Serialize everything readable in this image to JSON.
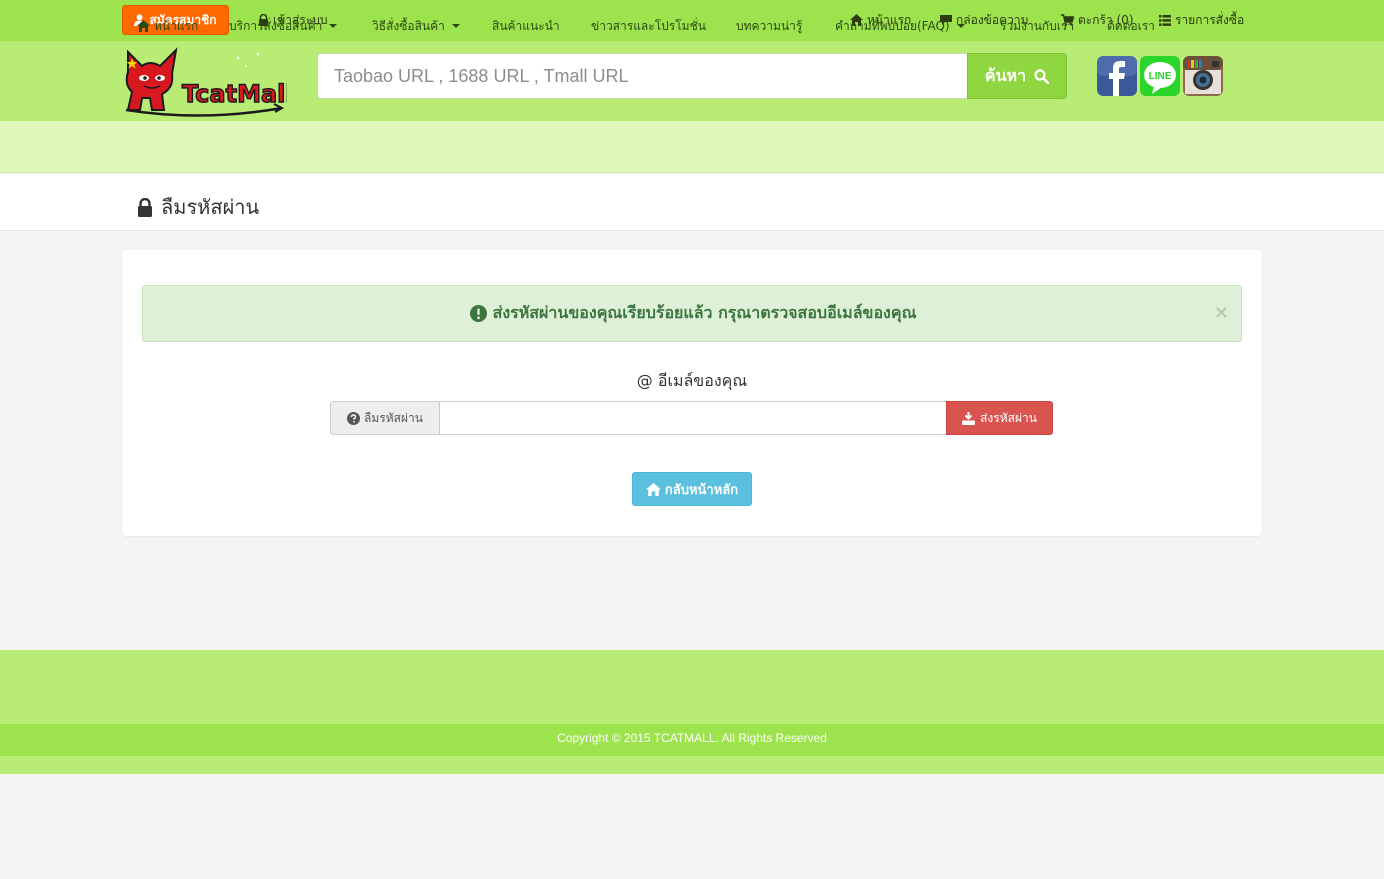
{
  "topbar": {
    "register_label": "สมัครสมาชิก",
    "login_label": "เข้าสู่ระบบ",
    "home_label": "หน้าแรก",
    "inbox_label": "กล่องข้อความ",
    "cart_label": "ตะกร้า (0)",
    "orders_label": "รายการสั่งซื้อ"
  },
  "header": {
    "logo_text": "TcatMall",
    "search": {
      "placeholder": "Taobao URL , 1688 URL , Tmall URL",
      "value": "",
      "button_label": "ค้นหา"
    },
    "social": [
      "facebook-icon",
      "line-icon",
      "instagram-icon"
    ],
    "social_line_text": "LINE"
  },
  "nav": {
    "items": [
      {
        "label": "หน้าแรก"
      },
      {
        "label": "บริการสั่งซื้อสินค้า"
      },
      {
        "label": "วิธีสั่งซื้อสินค้า"
      },
      {
        "label": "สินค้าแนะนำ"
      },
      {
        "label": "ข่าวสารและโปรโมชั่น"
      },
      {
        "label": "บทความน่ารู้"
      },
      {
        "label": "คำถามที่พบบ่อย(FAQ)"
      },
      {
        "label": "ร่วมงานกับเรา"
      },
      {
        "label": "ติดต่อเรา"
      }
    ]
  },
  "page": {
    "title": "ลืมรหัสผ่าน"
  },
  "alert": {
    "message": "ส่งรหัสผ่านของคุณเรียบร้อยแล้ว กรุณาตรวจสอบอีเมล์ของคุณ",
    "close": "×"
  },
  "form": {
    "email_label": "@ อีเมล์ของคุณ",
    "addon_label": "ลืมรหัสผ่าน",
    "email_value": "",
    "submit_label": "ส่งรหัสผ่าน",
    "back_label": "กลับหน้าหลัก"
  },
  "footer": {
    "copyright": "Copyright © 2015 TCATMALL. All Rights Reserved"
  },
  "colors": {
    "topbar": "#9de34d",
    "header": "#b8ec74",
    "navbar": "#dff7b8",
    "register": "#ff6a00",
    "search_button": "#8fd640",
    "alert_bg": "#dff0d8",
    "alert_text": "#3c763d",
    "submit": "#d9534f",
    "home_button": "#5bc0de"
  }
}
